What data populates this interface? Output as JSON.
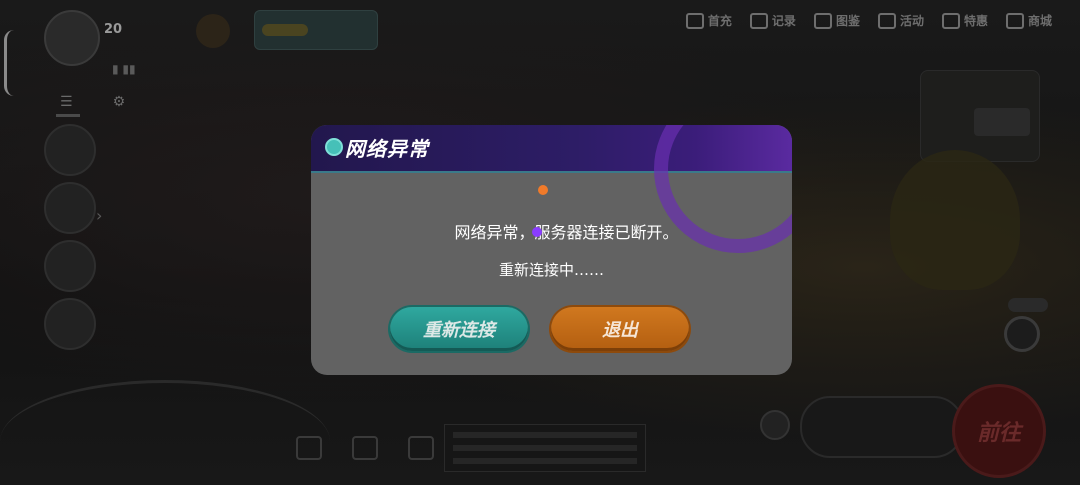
{
  "background": {
    "player": {
      "level": "20"
    },
    "nav": [
      {
        "label": "首充",
        "icon": "gift-icon"
      },
      {
        "label": "记录",
        "icon": "book-icon"
      },
      {
        "label": "图鉴",
        "icon": "dex-icon"
      },
      {
        "label": "活动",
        "icon": "calendar-icon"
      },
      {
        "label": "特惠",
        "icon": "tag-icon"
      },
      {
        "label": "商城",
        "icon": "cart-icon"
      }
    ],
    "go_button": "前往"
  },
  "dialog": {
    "title": "网络异常",
    "message": "网络异常，服务器连接已断开。",
    "status": "重新连接中……",
    "reconnect_button": "重新连接",
    "exit_button": "退出"
  },
  "colors": {
    "header_purple": "#2d1d66",
    "reconnect_teal": "#2fa89f",
    "exit_orange": "#d0781f",
    "dot_orange": "#f07a2a",
    "dot_purple": "#8a3cff"
  }
}
